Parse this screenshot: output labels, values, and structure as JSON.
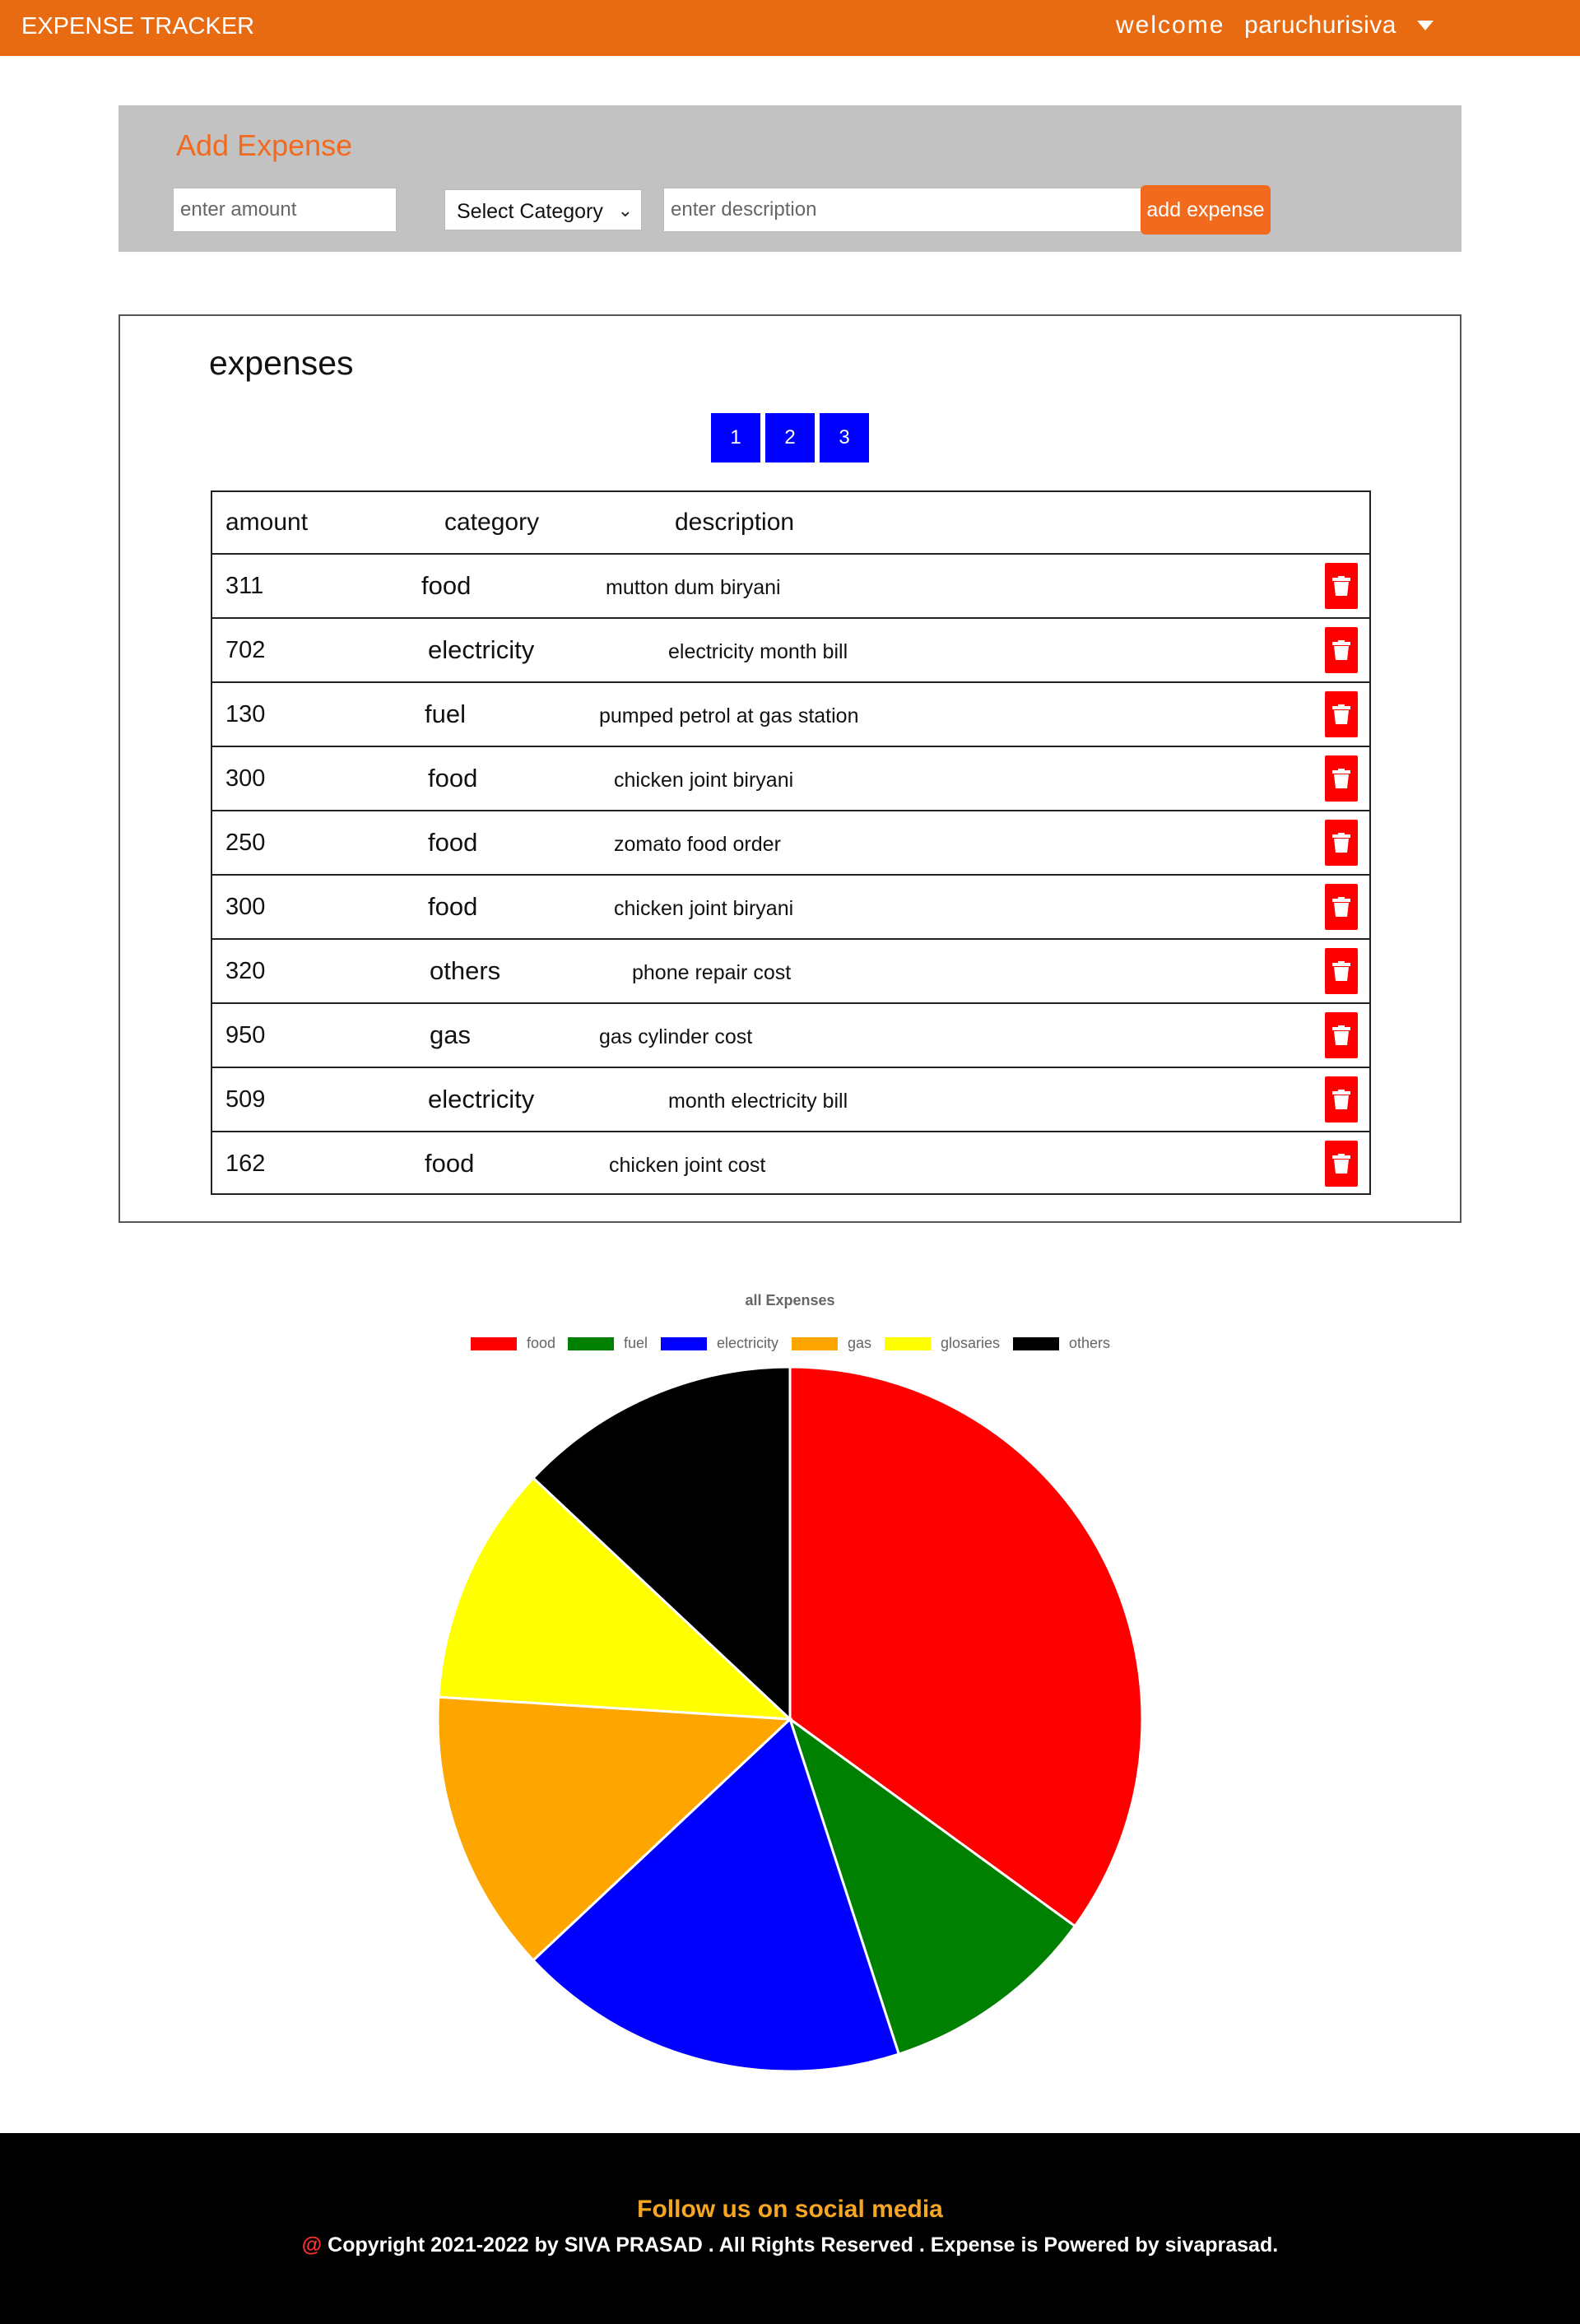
{
  "navbar": {
    "brand": "EXPENSE TRACKER",
    "welcome": "welcome",
    "username": "paruchurisiva",
    "menu_icon": "caret-down-icon"
  },
  "add_expense": {
    "title": "Add Expense",
    "amount_placeholder": "enter amount",
    "category_selected": "Select Category",
    "description_placeholder": "enter description",
    "button_label": "add expense",
    "accent": "#f26a1e"
  },
  "expenses": {
    "title": "expenses",
    "pages": [
      "1",
      "2",
      "3"
    ],
    "columns": [
      "amount",
      "category",
      "description"
    ],
    "rows": [
      {
        "amount": "311",
        "category": "food",
        "description": "mutton dum biryani"
      },
      {
        "amount": "702",
        "category": "electricity",
        "description": "electricity month bill"
      },
      {
        "amount": "130",
        "category": "fuel",
        "description": "pumped petrol at gas station"
      },
      {
        "amount": "300",
        "category": "food",
        "description": "chicken joint biryani"
      },
      {
        "amount": "250",
        "category": "food",
        "description": "zomato food order"
      },
      {
        "amount": "300",
        "category": "food",
        "description": "chicken joint biryani"
      },
      {
        "amount": "320",
        "category": "others",
        "description": "phone repair cost"
      },
      {
        "amount": "950",
        "category": "gas",
        "description": "gas cylinder cost"
      },
      {
        "amount": "509",
        "category": "electricity",
        "description": "month electricity bill"
      },
      {
        "amount": "162",
        "category": "food",
        "description": "chicken joint cost"
      }
    ],
    "delete_icon": "trash-icon",
    "delete_color": "#ff0000",
    "page_color": "#0000ff"
  },
  "chart_data": {
    "type": "pie",
    "title": "all  Expenses",
    "categories": [
      "food",
      "fuel",
      "electricity",
      "gas",
      "glosaries",
      "others"
    ],
    "values": [
      35,
      10,
      18,
      13,
      11,
      13
    ],
    "colors": [
      "#ff0000",
      "#008000",
      "#0000ff",
      "#ffa500",
      "#ffff00",
      "#000000"
    ],
    "legend_position": "top"
  },
  "footer": {
    "follow": "Follow us on social media",
    "at_symbol": "@",
    "copyright": " Copyright 2021-2022 by SIVA PRASAD . All Rights Reserved . Expense is Powered by sivaprasad."
  }
}
